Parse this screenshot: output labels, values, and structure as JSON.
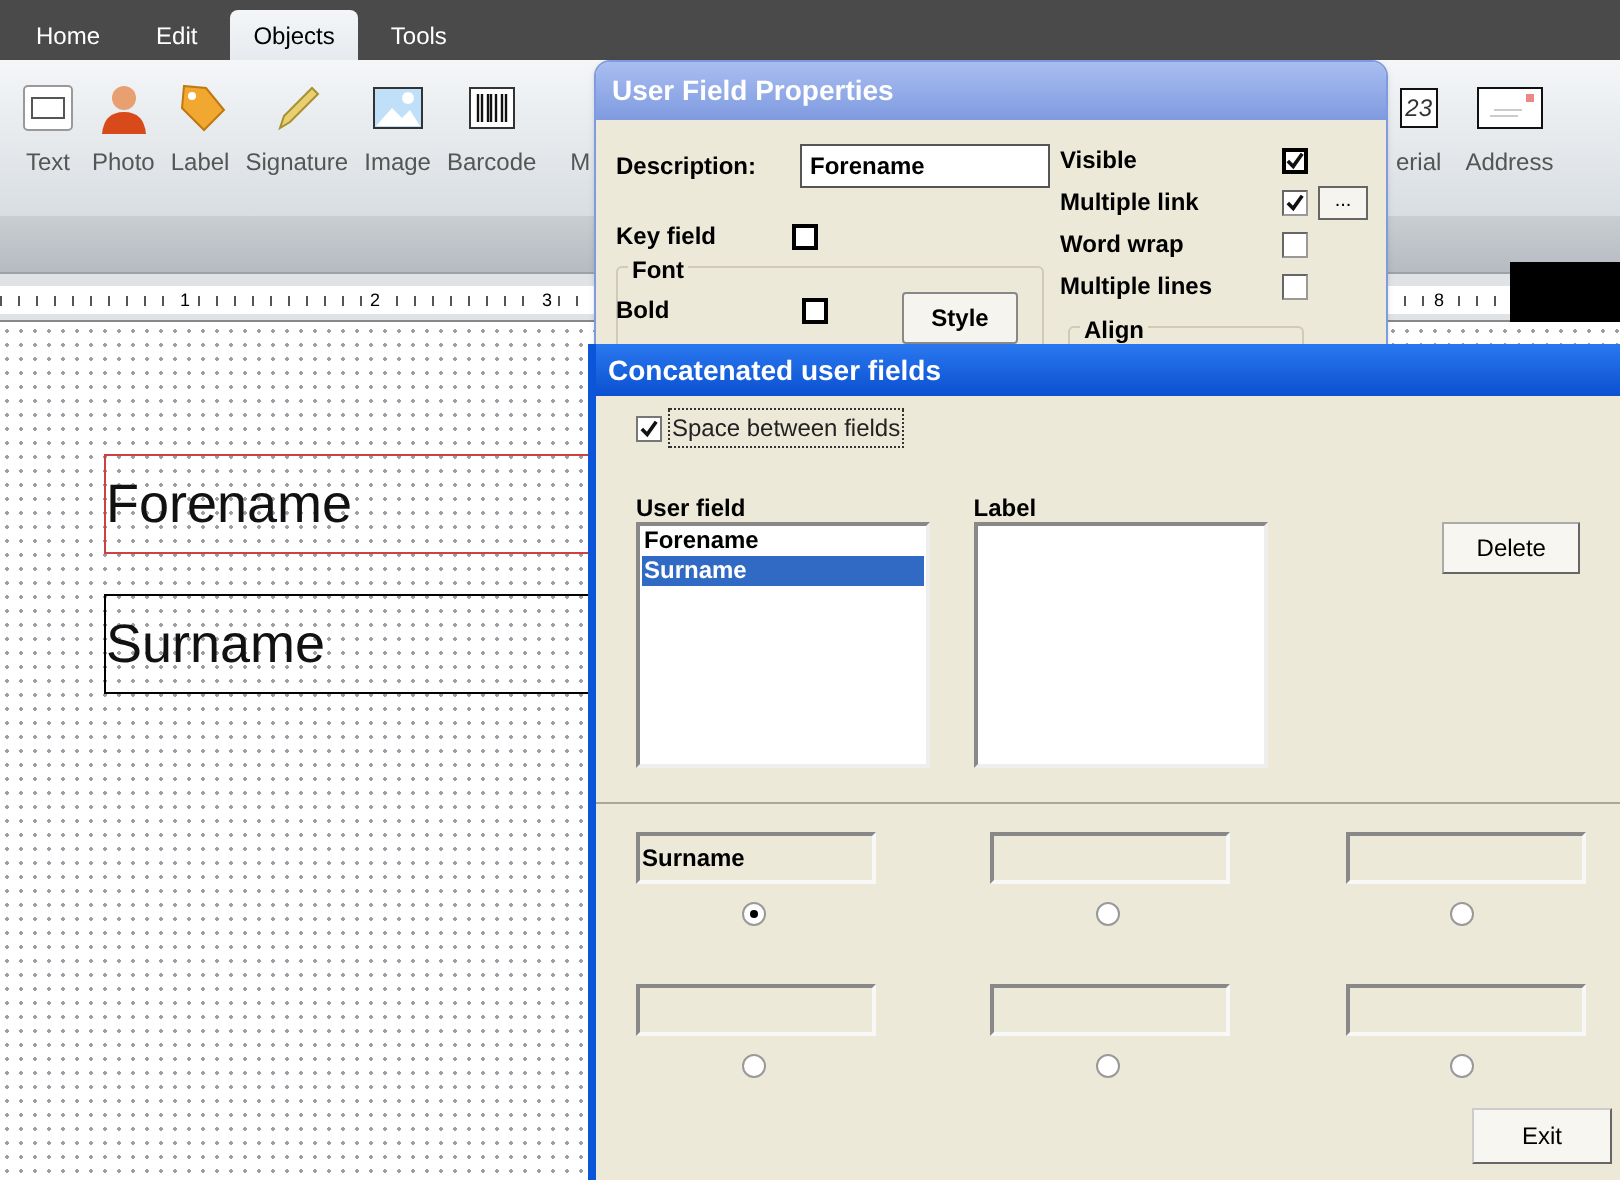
{
  "menu_tabs": [
    {
      "label": "Home",
      "selected": false
    },
    {
      "label": "Edit",
      "selected": false
    },
    {
      "label": "Objects",
      "selected": true
    },
    {
      "label": "Tools",
      "selected": false
    }
  ],
  "ribbon_tools": [
    {
      "label": "Text",
      "kind": "text"
    },
    {
      "label": "Photo",
      "kind": "photo"
    },
    {
      "label": "Label",
      "kind": "tag"
    },
    {
      "label": "Signature",
      "kind": "pencil"
    },
    {
      "label": "Image",
      "kind": "image"
    },
    {
      "label": "Barcode",
      "kind": "barcode"
    },
    {
      "label": "M",
      "kind": "none"
    }
  ],
  "ribbon_tools_right": [
    {
      "label": "erial",
      "kind": "number",
      "icon_text": "23"
    },
    {
      "label": "Address",
      "kind": "envelope"
    }
  ],
  "ruler_labels": [
    "1",
    "2",
    "3",
    "8"
  ],
  "canvas_fields": [
    {
      "text": "Forename",
      "selected": true
    },
    {
      "text": "Surname",
      "selected": false
    }
  ],
  "user_field_properties": {
    "title": "User Field Properties",
    "description_label": "Description:",
    "description_value": "Forename",
    "key_field": {
      "label": "Key field",
      "checked": false
    },
    "font_group": "Font",
    "bold": {
      "label": "Bold",
      "checked": false
    },
    "style_button": "Style",
    "options": [
      {
        "label": "Visible",
        "checked": true
      },
      {
        "label": "Multiple link",
        "checked": true,
        "button_label": "..."
      },
      {
        "label": "Word wrap",
        "checked": false
      },
      {
        "label": "Multiple lines",
        "checked": false
      }
    ],
    "align_group": "Align"
  },
  "concatenated_user_fields": {
    "title": "Concatenated user fields",
    "space_between_fields": {
      "label": "Space between fields",
      "checked": true
    },
    "user_field_heading": "User field",
    "user_fields": [
      {
        "text": "Forename",
        "selected": false
      },
      {
        "text": "Surname",
        "selected": true
      }
    ],
    "label_heading": "Label",
    "delete_button": "Delete",
    "slots": [
      {
        "value": "Surname",
        "selected": true
      },
      {
        "selected": false
      },
      {
        "selected": false
      },
      {
        "selected": false
      },
      {
        "selected": false
      },
      {
        "selected": false
      }
    ],
    "exit_button": "Exit"
  }
}
